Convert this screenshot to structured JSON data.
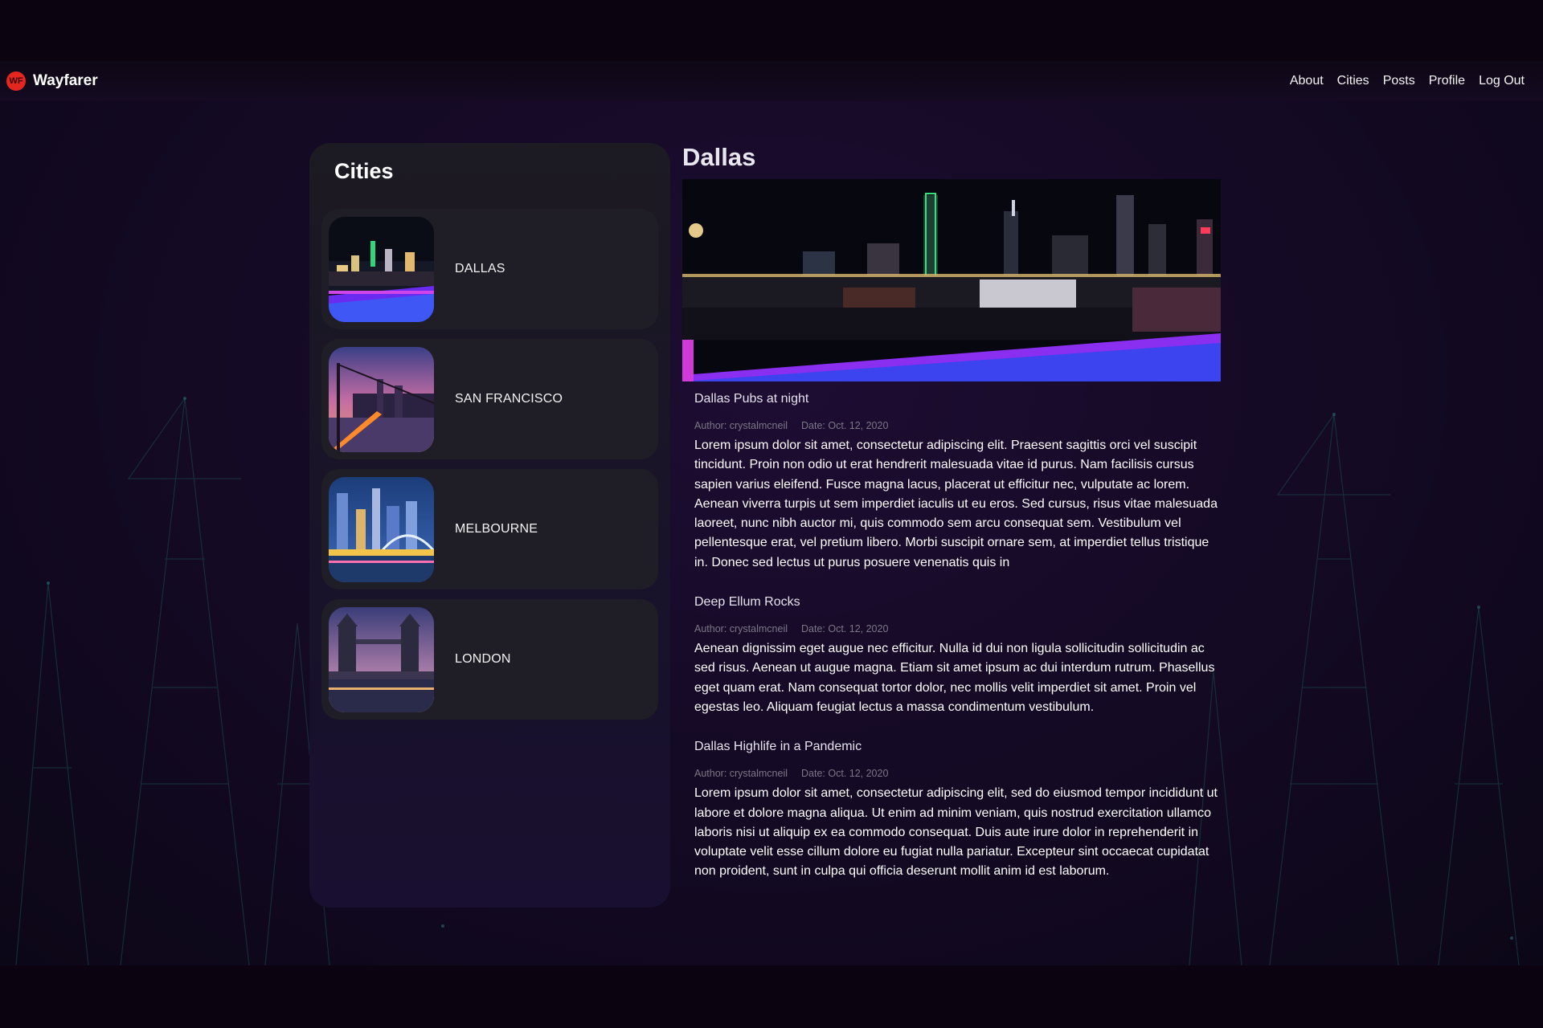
{
  "app": {
    "name": "Wayfarer",
    "logo_text": "WF"
  },
  "nav": {
    "links": [
      "About",
      "Cities",
      "Posts",
      "Profile",
      "Log Out"
    ]
  },
  "cities_panel": {
    "title": "Cities",
    "cities": [
      {
        "name": "DALLAS",
        "thumb": "dallas-night-skyline"
      },
      {
        "name": "SAN FRANCISCO",
        "thumb": "san-francisco-bay-bridge-dusk"
      },
      {
        "name": "MELBOURNE",
        "thumb": "melbourne-river-skyline-night"
      },
      {
        "name": "LONDON",
        "thumb": "london-tower-bridge-dusk"
      }
    ]
  },
  "detail": {
    "city_title": "Dallas",
    "banner": "dallas-rooftop-pool-night-skyline",
    "posts": [
      {
        "title": "Dallas Pubs at night",
        "author": "Author: crystalmcneil",
        "date": "Date: Oct. 12, 2020",
        "body": "Lorem ipsum dolor sit amet, consectetur adipiscing elit. Praesent sagittis orci vel suscipit tincidunt. Proin non odio ut erat hendrerit malesuada vitae id purus. Nam facilisis cursus sapien varius eleifend. Fusce magna lacus, placerat ut efficitur nec, vulputate ac lorem. Aenean viverra turpis ut sem imperdiet iaculis ut eu eros. Sed cursus, risus vitae malesuada laoreet, nunc nibh auctor mi, quis commodo sem arcu consequat sem. Vestibulum vel pellentesque erat, vel pretium libero. Morbi suscipit ornare sem, at imperdiet tellus tristique in. Donec sed lectus ut purus posuere venenatis quis in"
      },
      {
        "title": "Deep Ellum Rocks",
        "author": "Author: crystalmcneil",
        "date": "Date: Oct. 12, 2020",
        "body": "Aenean dignissim eget augue nec efficitur. Nulla id dui non ligula sollicitudin sollicitudin ac sed risus. Aenean ut augue magna. Etiam sit amet ipsum ac dui interdum rutrum. Phasellus eget quam erat. Nam consequat tortor dolor, nec mollis velit imperdiet sit amet. Proin vel egestas leo. Aliquam feugiat lectus a massa condimentum vestibulum."
      },
      {
        "title": "Dallas Highlife in a Pandemic",
        "author": "Author: crystalmcneil",
        "date": "Date: Oct. 12, 2020",
        "body": "Lorem ipsum dolor sit amet, consectetur adipiscing elit, sed do eiusmod tempor incididunt ut labore et dolore magna aliqua. Ut enim ad minim veniam, quis nostrud exercitation ullamco laboris nisi ut aliquip ex ea commodo consequat. Duis aute irure dolor in reprehenderit in voluptate velit esse cillum dolore eu fugiat nulla pariatur. Excepteur sint occaecat cupidatat non proident, sunt in culpa qui officia deserunt mollit anim id est laborum."
      }
    ]
  },
  "colors": {
    "page_black": "#0b0410",
    "app_purple": "#1e0d33",
    "panel": "#1c1a22",
    "card": "#1f1d25",
    "logo_red": "#e3271e",
    "meta_gray": "#7b7785"
  }
}
